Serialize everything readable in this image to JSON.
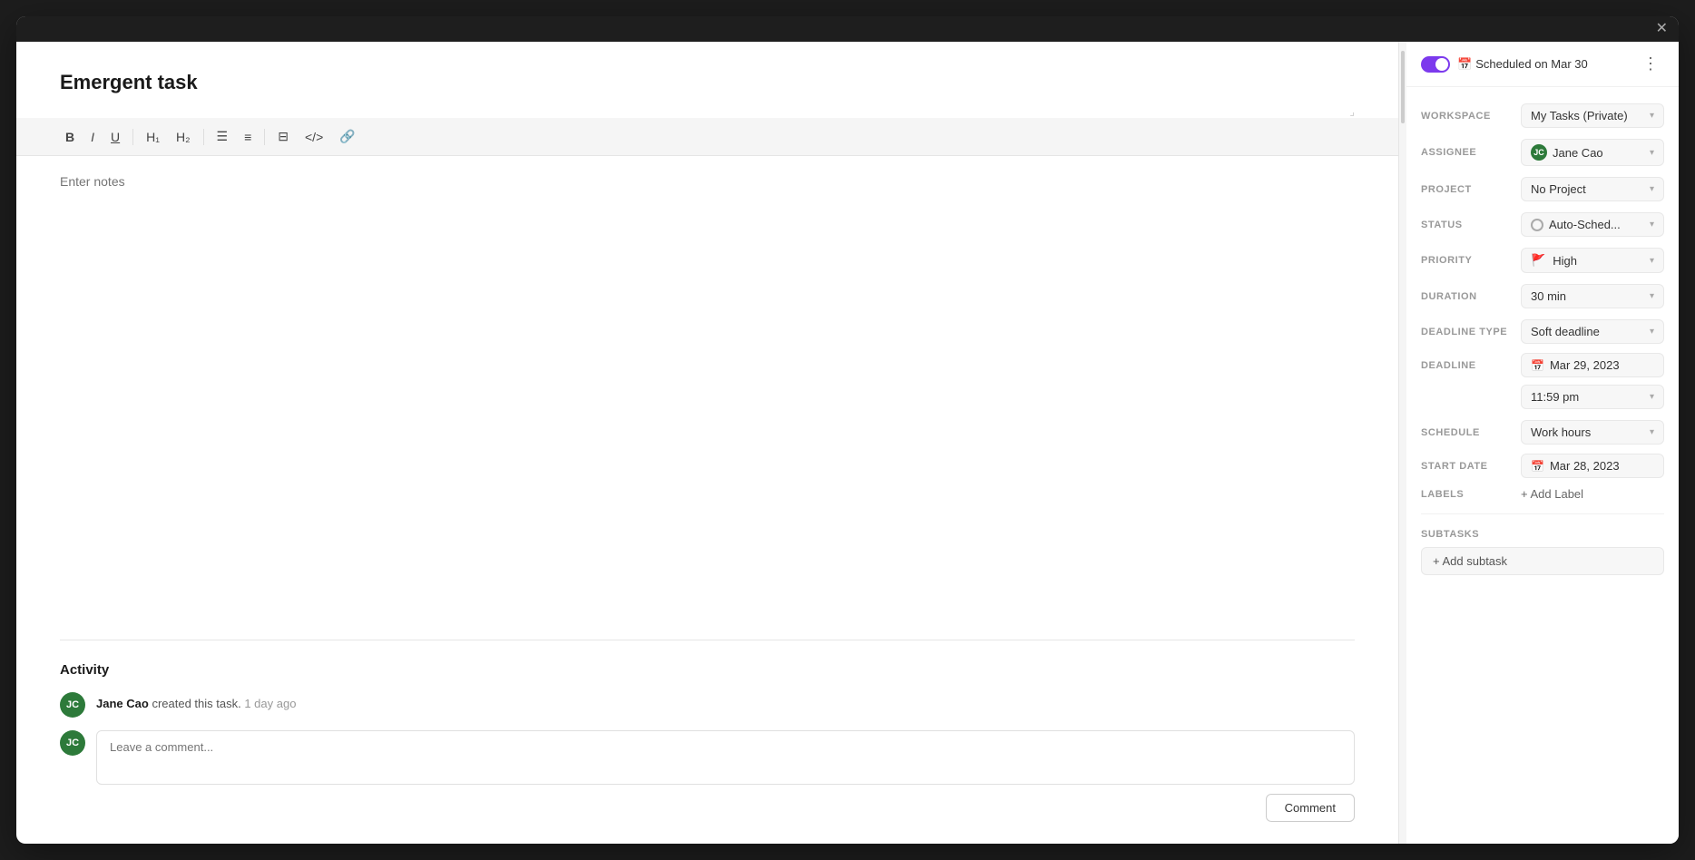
{
  "modal": {
    "close_label": "✕"
  },
  "header": {
    "scheduled_label": "Scheduled on Mar 30",
    "more_icon": "⋮"
  },
  "task": {
    "title": "Emergent task",
    "notes_placeholder": "Enter notes",
    "resize_handle": "⌟"
  },
  "toolbar": {
    "bold": "B",
    "italic": "I",
    "underline": "U",
    "h1": "H₁",
    "h2": "H₂",
    "bullet_list": "☰",
    "ordered_list": "≡",
    "image": "⊟",
    "code": "</>",
    "link": "🔗"
  },
  "properties": {
    "workspace_label": "WORKSPACE",
    "workspace_value": "My Tasks (Private)",
    "assignee_label": "ASSIGNEE",
    "assignee_value": "Jane Cao",
    "assignee_initials": "JC",
    "project_label": "PROJECT",
    "project_value": "No Project",
    "status_label": "STATUS",
    "status_value": "Auto-Sched...",
    "priority_label": "PRIORITY",
    "priority_value": "High",
    "duration_label": "DURATION",
    "duration_value": "30 min",
    "deadline_type_label": "DEADLINE TYPE",
    "deadline_type_value": "Soft deadline",
    "deadline_label": "DEADLINE",
    "deadline_date": "Mar 29, 2023",
    "deadline_time": "11:59 pm",
    "schedule_label": "SCHEDULE",
    "schedule_value": "Work hours",
    "start_date_label": "START DATE",
    "start_date_value": "Mar 28, 2023",
    "labels_label": "LABELS",
    "add_label_text": "+ Add Label"
  },
  "subtasks": {
    "section_title": "SUBTASKS",
    "add_subtask_text": "+ Add subtask"
  },
  "activity": {
    "section_title": "Activity",
    "items": [
      {
        "user": "Jane Cao",
        "action": "created this task.",
        "time": "1 day ago",
        "initials": "JC"
      }
    ],
    "comment_placeholder": "Leave a comment...",
    "comment_btn": "Comment"
  }
}
